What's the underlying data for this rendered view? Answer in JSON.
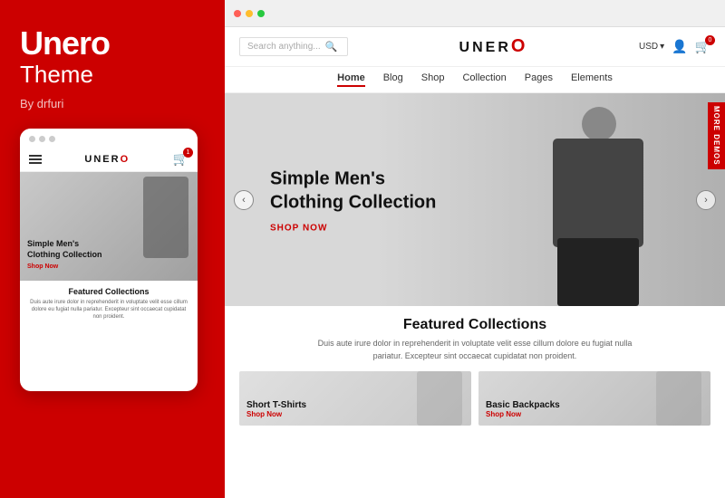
{
  "left": {
    "brand": "Unero",
    "theme_label": "Theme",
    "author": "By drfuri"
  },
  "mobile_mockup": {
    "logo_text": "UNERO",
    "cart_count": "1",
    "hero_title": "Simple Men's Clothing Collection",
    "shop_now": "Shop Now",
    "featured_title": "Featured Collections",
    "featured_desc": "Duis aute irure dolor in reprehenderit in voluptate velit esse cillum dolore eu fugiat nulla pariatur. Excepteur sint occaecat cupidatat non proident."
  },
  "browser": {
    "dots": [
      "red",
      "yellow",
      "green"
    ],
    "search_placeholder": "Search anything...",
    "logo": "UNERO",
    "currency": "USD",
    "cart_count": "0",
    "nav_items": [
      {
        "label": "Home",
        "active": true
      },
      {
        "label": "Blog",
        "active": false
      },
      {
        "label": "Shop",
        "active": false
      },
      {
        "label": "Collection",
        "active": false
      },
      {
        "label": "Pages",
        "active": false
      },
      {
        "label": "Elements",
        "active": false
      }
    ],
    "hero": {
      "title": "Simple Men's Clothing Collection",
      "shop_now": "Shop Now",
      "more_demos": "MORE DEMOS"
    },
    "featured": {
      "title": "Featured Collections",
      "description": "Duis aute irure dolor in reprehenderit in voluptate velit esse cillum dolore eu fugiat nulla pariatur. Excepteur sint occaecat cupidatat non proident.",
      "cards": [
        {
          "title": "Short T-Shirts",
          "link": "Shop Now"
        },
        {
          "title": "Basic Backpacks",
          "link": "Shop Now"
        }
      ]
    }
  }
}
